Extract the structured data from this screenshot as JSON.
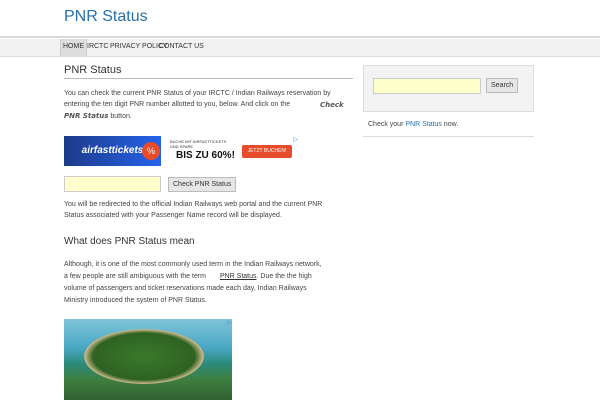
{
  "site": {
    "title": "PNR Status"
  },
  "nav": {
    "items": [
      "HOME",
      "IRCTC",
      "PRIVACY POLICY",
      "CONTACT US"
    ]
  },
  "main": {
    "heading": "PNR Status",
    "intro_1": "You can check the current PNR Status of your IRCTC / Indian Railways reservation by",
    "intro_2": "entering the ten digit PNR number allotted to you, below. And click on the",
    "intro_em": "Check PNR Status",
    "intro_3": "button.",
    "form": {
      "input_value": "",
      "button_label": "Check PNR Status"
    },
    "redirect_1": "You will be redirected to the official Indian Railways web portal and the current PNR",
    "redirect_2": "Status associated with your Passenger Name record will be displayed.",
    "section_heading": "What does PNR Status mean",
    "para_1": "Although, it is one of the most commonly used term in the Indian Railways network,",
    "para_2a": "a few people are still ambiguous with the term",
    "para_2_link": "PNR Status",
    "para_2b": ". Due the the high",
    "para_3": "volume of passengers and ticket reservations made each day, Indian Railways",
    "para_4": "Ministry introduced the system of PNR Status."
  },
  "ad_banner": {
    "brand": "airfasttickets",
    "small": "BUCHE MIT AIRFASTTICKETS UND SPARE",
    "big": "BIS ZU 60%!",
    "cta": "JETZT BUCHEN!",
    "info": "▷"
  },
  "sidebar": {
    "input_value": "",
    "search_label": "Search",
    "text_before": "Check your",
    "text_link": "PNR Status",
    "text_after": "now."
  },
  "colors": {
    "brand": "#2a6fa8",
    "input_bg": "#ffffcc",
    "ad_red": "#e74c2b"
  }
}
